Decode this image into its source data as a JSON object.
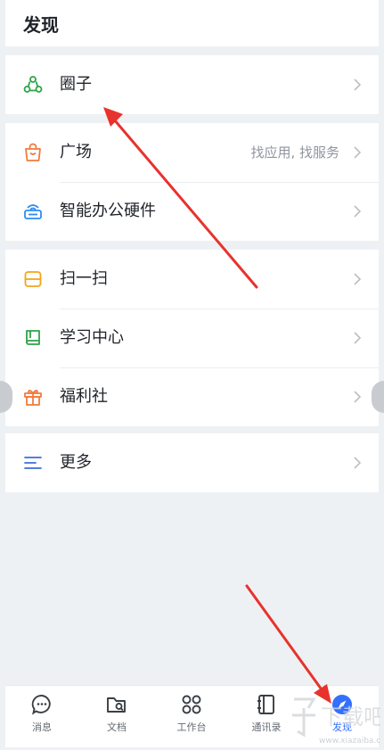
{
  "header": {
    "title": "发现"
  },
  "section1": [
    {
      "label": "圈子",
      "hint": "",
      "icon": "circle-people-icon",
      "color": "#2ea34a"
    }
  ],
  "section2": [
    {
      "label": "广场",
      "hint": "找应用, 找服务",
      "icon": "shopping-bag-icon",
      "color": "#f07b3f"
    },
    {
      "label": "智能办公硬件",
      "hint": "",
      "icon": "router-icon",
      "color": "#2f8cf0"
    }
  ],
  "section3": [
    {
      "label": "扫一扫",
      "hint": "",
      "icon": "scan-icon",
      "color": "#f2a51a"
    },
    {
      "label": "学习中心",
      "hint": "",
      "icon": "book-icon",
      "color": "#2ea34a"
    },
    {
      "label": "福利社",
      "hint": "",
      "icon": "gift-icon",
      "color": "#f07b3f"
    }
  ],
  "section4": [
    {
      "label": "更多",
      "hint": "",
      "icon": "menu-lines-icon",
      "color": "#3c6fd6"
    }
  ],
  "tabbar": {
    "items": [
      {
        "label": "消息",
        "icon": "chat-bubble-icon",
        "active": false
      },
      {
        "label": "文档",
        "icon": "folder-icon",
        "active": false
      },
      {
        "label": "工作台",
        "icon": "grid-icon",
        "active": false
      },
      {
        "label": "通讯录",
        "icon": "contacts-icon",
        "active": false
      },
      {
        "label": "发现",
        "icon": "compass-icon",
        "active": true
      }
    ]
  },
  "colors": {
    "accent": "#3370ff",
    "annotation_arrow": "#e8322d",
    "background": "#eef1f4"
  },
  "watermark": {
    "main": "下载吧",
    "url": "www.xiazaiba.com"
  }
}
